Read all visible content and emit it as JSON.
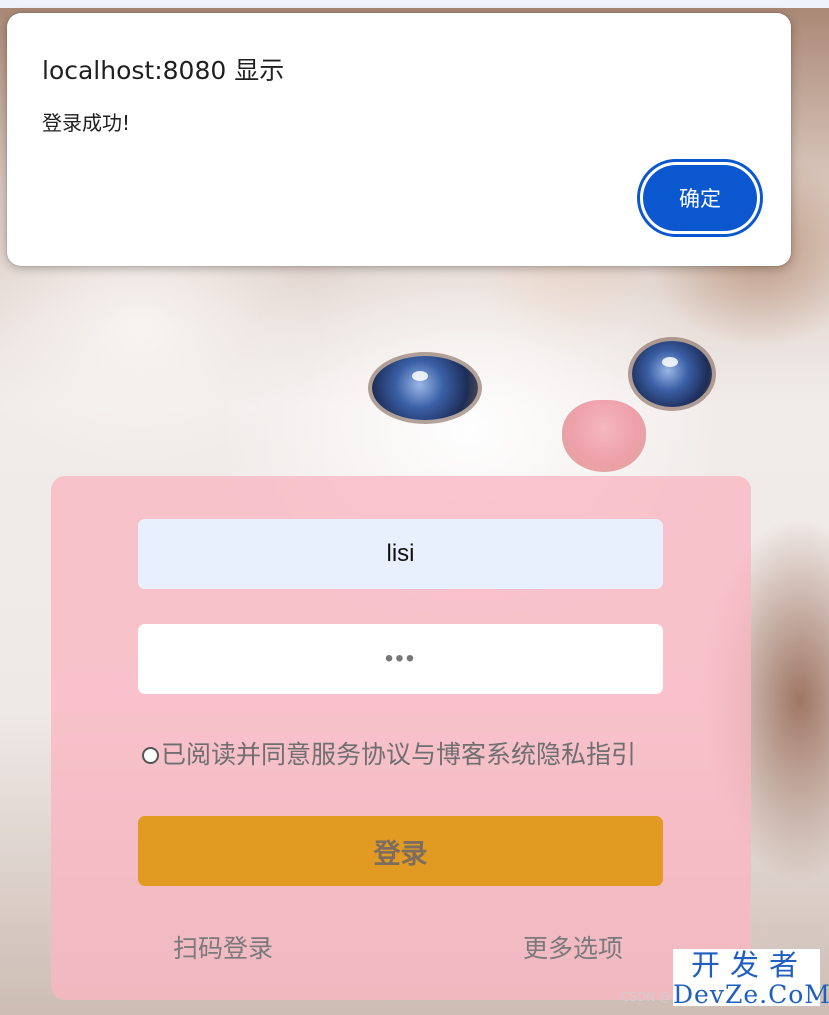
{
  "alert": {
    "title": "localhost:8080 显示",
    "message": "登录成功!",
    "ok_label": "确定",
    "accent_color": "#0b57d0"
  },
  "login": {
    "username_value": "lisi",
    "password_value": "•••",
    "agreement_text": "已阅读并同意服务协议与博客系统隐私指引",
    "agreement_checked": false,
    "login_button_label": "登录",
    "qr_login_label": "扫码登录",
    "more_options_label": "更多选项",
    "card_color": "#f9b6c3",
    "button_color": "#e19a22"
  },
  "watermarks": {
    "csdn": "CSDN @",
    "logo_cn": "开发者",
    "logo_en": "DevZe.CoM"
  }
}
